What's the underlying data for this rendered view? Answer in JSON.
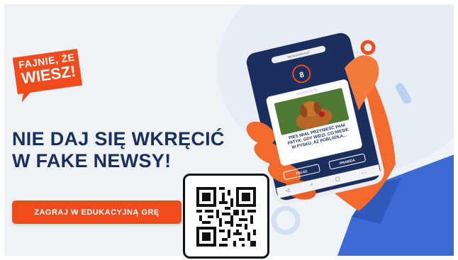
{
  "logo": {
    "line1": "FAJNIE, ŻE",
    "line2": "WIESZ!"
  },
  "headline": {
    "line1": "NIE DAJ SIĘ WKRĘCIĆ",
    "line2": "W FAKE NEWSY!"
  },
  "cta": {
    "label": "ZAGRAJ W EDUKACYJNĄ GRĘ"
  },
  "phone": {
    "status_time": "9:41",
    "url": "fajniezewiesz.pl",
    "score": "8",
    "card_tag": "ZWIERZĘTA",
    "card_text": "PIES MIAŁ PRZYNIEŚĆ PANI PATYK. GDY WIDZI, CO NIESIE W PYSKU, AŻ POBLADŁA...",
    "false_label": "FAŁSZ",
    "true_label": "PRAWDA",
    "bar_icons": [
      "◁",
      "⌕",
      "▢",
      "⋯"
    ]
  },
  "colors": {
    "accent": "#f04a1d",
    "navy": "#1b2f5e",
    "background": "#eef3f8",
    "sleeve": "#3d6bd6",
    "hand": "#f26a2e"
  },
  "icons": [
    "qr-code-icon",
    "speech-bubble-icon"
  ]
}
